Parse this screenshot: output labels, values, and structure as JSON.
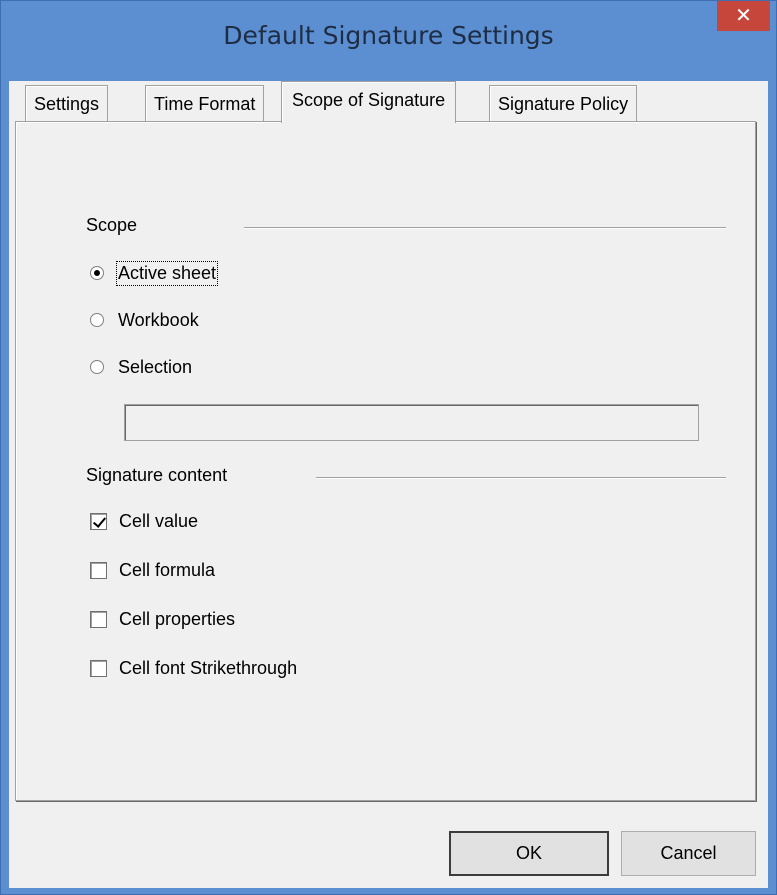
{
  "window": {
    "title": "Default Signature Settings",
    "close_glyph": "✕"
  },
  "tabs": [
    {
      "label": "Settings",
      "active": false
    },
    {
      "label": "Time Format",
      "active": false
    },
    {
      "label": "Scope of Signature",
      "active": true
    },
    {
      "label": "Signature Policy",
      "active": false
    }
  ],
  "scope": {
    "heading": "Scope",
    "options": [
      {
        "label": "Active sheet",
        "selected": true
      },
      {
        "label": "Workbook",
        "selected": false
      },
      {
        "label": "Selection",
        "selected": false
      }
    ],
    "selection_value": ""
  },
  "signature_content": {
    "heading": "Signature content",
    "items": [
      {
        "label": "Cell value",
        "checked": true
      },
      {
        "label": "Cell formula",
        "checked": false
      },
      {
        "label": "Cell properties",
        "checked": false
      },
      {
        "label": "Cell font Strikethrough",
        "checked": false
      }
    ]
  },
  "buttons": {
    "ok": "OK",
    "cancel": "Cancel"
  }
}
